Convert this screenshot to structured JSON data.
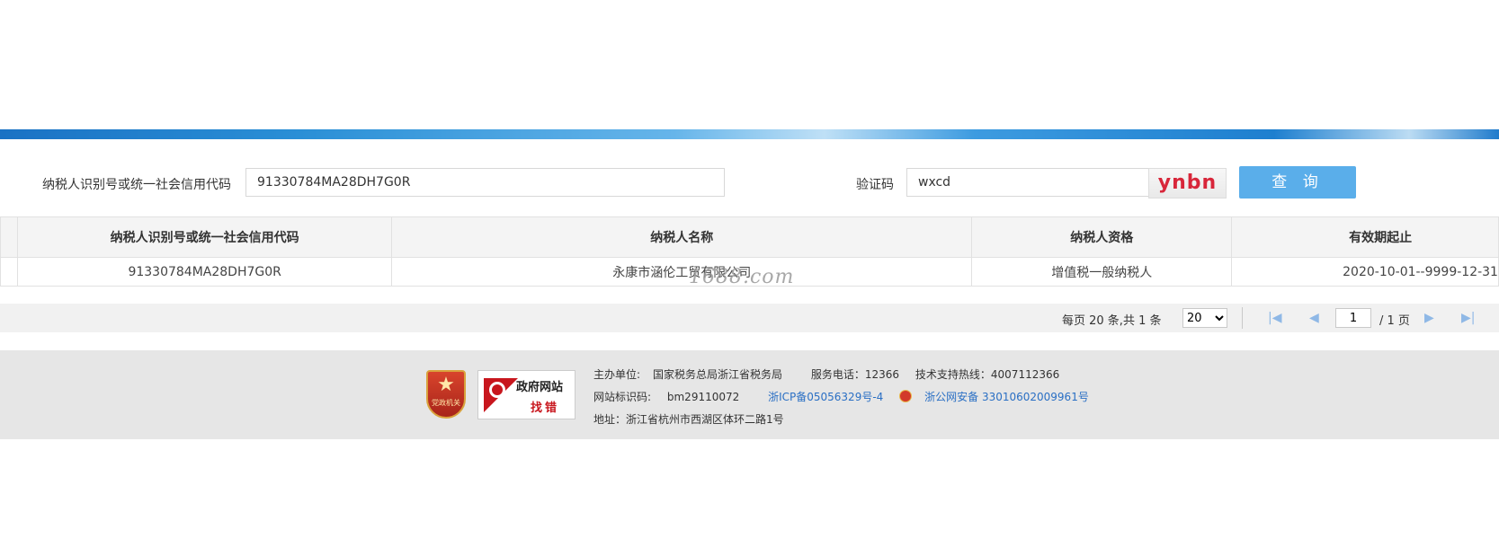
{
  "search": {
    "taxpayer_id_label": "纳税人识别号或统一社会信用代码",
    "taxpayer_id_value": "91330784MA28DH7G0R",
    "captcha_label": "验证码",
    "captcha_value": "wxcd",
    "captcha_image_text": "ynbn",
    "query_button": "查 询"
  },
  "table": {
    "columns": [
      "纳税人识别号或统一社会信用代码",
      "纳税人名称",
      "纳税人资格",
      "有效期起止"
    ],
    "rows": [
      {
        "id": "91330784MA28DH7G0R",
        "name": "永康市涵伦工贸有限公司",
        "qualification": "增值税一般纳税人",
        "validity": "2020-10-01--9999-12-31"
      }
    ]
  },
  "watermark": "1688.com",
  "pager": {
    "summary": "每页 20 条,共 1 条",
    "page_size": "20",
    "current_page": "1",
    "total_pages": "/ 1 页"
  },
  "footer": {
    "emblem_caption": "党政机关",
    "gov_site_title": "政府网站",
    "gov_site_subtitle": "找错",
    "host_label": "主办单位:",
    "host_value": "国家税务总局浙江省税务局",
    "service_phone": "服务电话：12366",
    "support_hotline": "技术支持热线：4007112366",
    "site_code_label": "网站标识码:",
    "site_code_value": "bm29110072",
    "icp": "浙ICP备05056329号-4",
    "police_record": "浙公网安备 33010602009961号",
    "address": "地址：浙江省杭州市西湖区体环二路1号"
  },
  "colors": {
    "query_button": "#5aaeea",
    "captcha_text": "#d8263a",
    "link": "#2a6fc4"
  }
}
